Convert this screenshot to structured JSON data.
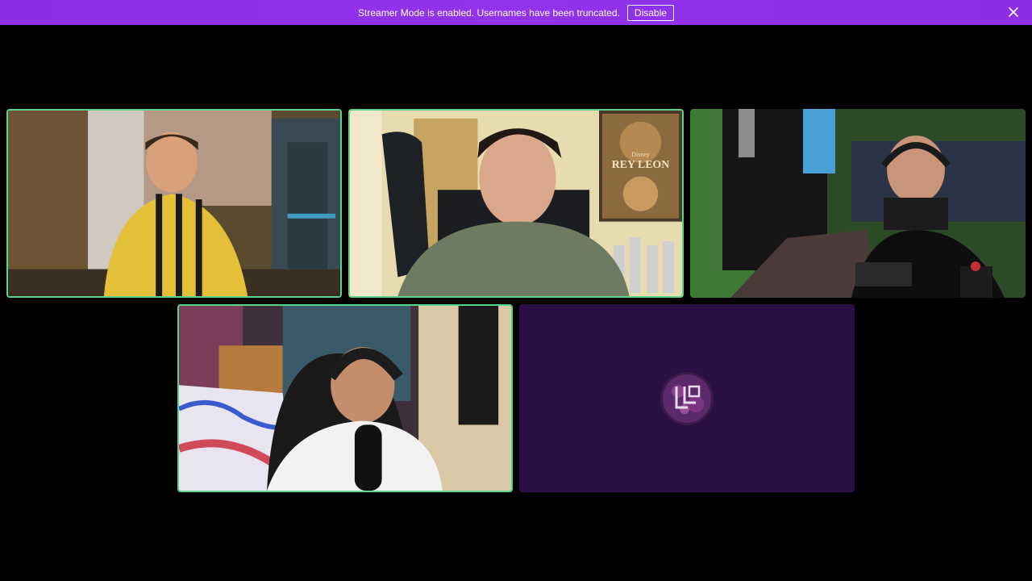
{
  "banner": {
    "message": "Streamer Mode is enabled. Usernames have been truncated.",
    "disable_label": "Disable",
    "background": "#8b2ee6"
  },
  "icons": {
    "close": "close-icon"
  },
  "participants": [
    {
      "id": "participant-1",
      "speaking": true,
      "video": true
    },
    {
      "id": "participant-2",
      "speaking": true,
      "video": true
    },
    {
      "id": "participant-3",
      "speaking": false,
      "video": true
    },
    {
      "id": "participant-4",
      "speaking": true,
      "video": true
    },
    {
      "id": "participant-5",
      "speaking": false,
      "video": false,
      "avatar": "avatar-logo"
    }
  ],
  "poster": {
    "brand": "Disney",
    "title": "REY LEON"
  },
  "colors": {
    "speaking_border": "#5bd48a",
    "placeholder_bg": "#2a0f45"
  }
}
